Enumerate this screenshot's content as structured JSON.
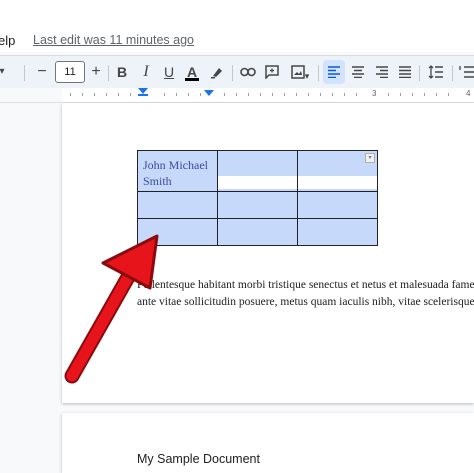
{
  "menu": {
    "help_label": "elp",
    "last_edit": "Last edit was 11 minutes ago"
  },
  "toolbar": {
    "font_size": "11",
    "minus": "−",
    "plus": "+",
    "bold": "B",
    "italic": "I",
    "underline": "U",
    "text_color": "A"
  },
  "ruler": {
    "marks": [
      "1",
      "2",
      "3",
      "4"
    ]
  },
  "table": {
    "rows": [
      [
        "John Michael Smith",
        "",
        ""
      ],
      [
        "",
        "",
        ""
      ],
      [
        "",
        "",
        ""
      ]
    ]
  },
  "paragraph": {
    "line1": "Pellentesque habitant morbi tristique senectus et netus et malesuada fames",
    "line2": "ante vitae sollicitudin posuere, metus quam iaculis nibh, vitae scelerisque"
  },
  "page2": {
    "text": "My Sample Document"
  },
  "colors": {
    "accent": "#0b57d0",
    "selection": "#c6d9fa",
    "arrow": "#e8141b"
  },
  "icons": [
    "chevron-down-icon",
    "paint-format-icon",
    "link-icon",
    "comment-icon",
    "image-icon",
    "align-left-icon",
    "align-center-icon",
    "align-right-icon",
    "justify-icon",
    "line-spacing-icon",
    "numbered-list-icon"
  ]
}
